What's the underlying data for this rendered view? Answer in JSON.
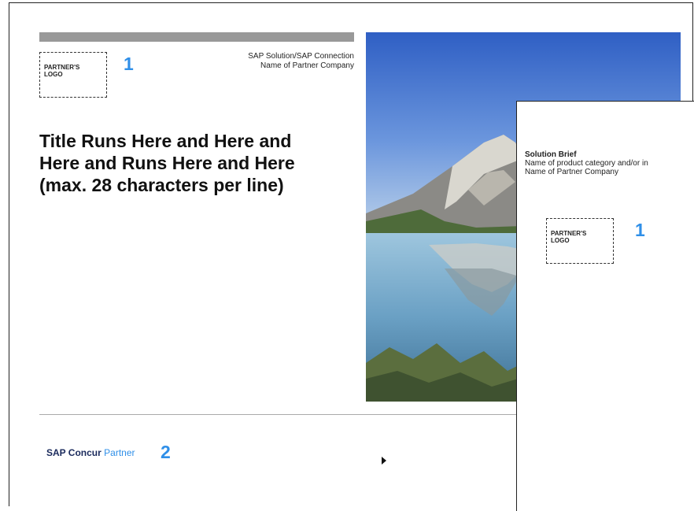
{
  "cover": {
    "logo_label_line1": "PARTNER'S",
    "logo_label_line2": "LOGO",
    "callout_number": "1",
    "solution_line": "SAP Solution/SAP Connection",
    "partner_company": "Name of Partner Company",
    "title_lines": [
      "Title Runs Here and Here and",
      "Here and Runs Here and Here",
      "(max. 28 characters per line)"
    ],
    "photo_description_icon": "mountain-lake-photo",
    "footer_brand": "SAP Concur",
    "footer_partner": "Partner",
    "footer_callout_number": "2"
  },
  "back_page": {
    "brief_title": "Solution Brief",
    "brief_line1": "Name of product category and/or in",
    "brief_line2": "Name of Partner Company",
    "logo_label_line1": "PARTNER'S",
    "logo_label_line2": "LOGO",
    "callout_number": "1"
  },
  "colors": {
    "accent_blue": "#2f8fe8",
    "concur_navy": "#1a2a5c",
    "gray_bar": "#999999"
  }
}
